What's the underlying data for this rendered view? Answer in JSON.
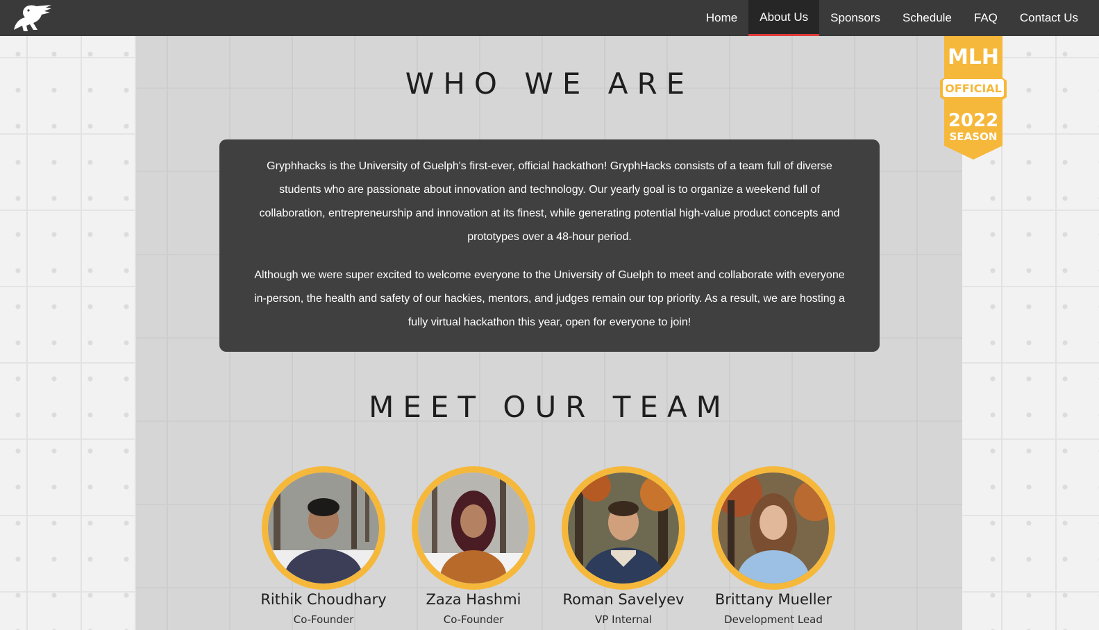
{
  "nav": {
    "logo_icon": "griffin-logo-icon",
    "items": [
      {
        "label": "Home",
        "active": false
      },
      {
        "label": "About Us",
        "active": true
      },
      {
        "label": "Sponsors",
        "active": false
      },
      {
        "label": "Schedule",
        "active": false
      },
      {
        "label": "FAQ",
        "active": false
      },
      {
        "label": "Contact Us",
        "active": false
      }
    ]
  },
  "badge": {
    "line1": "MLH",
    "line2": "OFFICIAL",
    "line3": "2022",
    "line4": "SEASON"
  },
  "who_we_are": {
    "heading": "WHO WE ARE",
    "paragraphs": [
      "Gryphhacks is the University of Guelph's first-ever, official hackathon! GryphHacks consists of a team full of diverse students who are passionate about innovation and technology. Our yearly goal is to organize a weekend full of collaboration, entrepreneurship and innovation at its finest, while generating potential high-value product concepts and prototypes over a 48-hour period.",
      "Although we were super excited to welcome everyone to the University of Guelph to meet and collaborate with everyone in-person, the health and safety of our hackies, mentors, and judges remain our top priority. As a result, we are hosting a fully virtual hackathon this year, open for everyone to join!"
    ]
  },
  "team": {
    "heading": "MEET OUR TEAM",
    "members": [
      {
        "name": "Rithik Choudhary",
        "role": "Co-Founder"
      },
      {
        "name": "Zaza Hashmi",
        "role": "Co-Founder"
      },
      {
        "name": "Roman Savelyev",
        "role": "VP Internal"
      },
      {
        "name": "Brittany Mueller",
        "role": "Development Lead"
      }
    ]
  },
  "colors": {
    "navbar": "#3a3a3a",
    "active_underline": "#e03c3c",
    "avatar_ring": "#f6b83a",
    "badge": "#f6b83a",
    "about_box": "#404040"
  }
}
